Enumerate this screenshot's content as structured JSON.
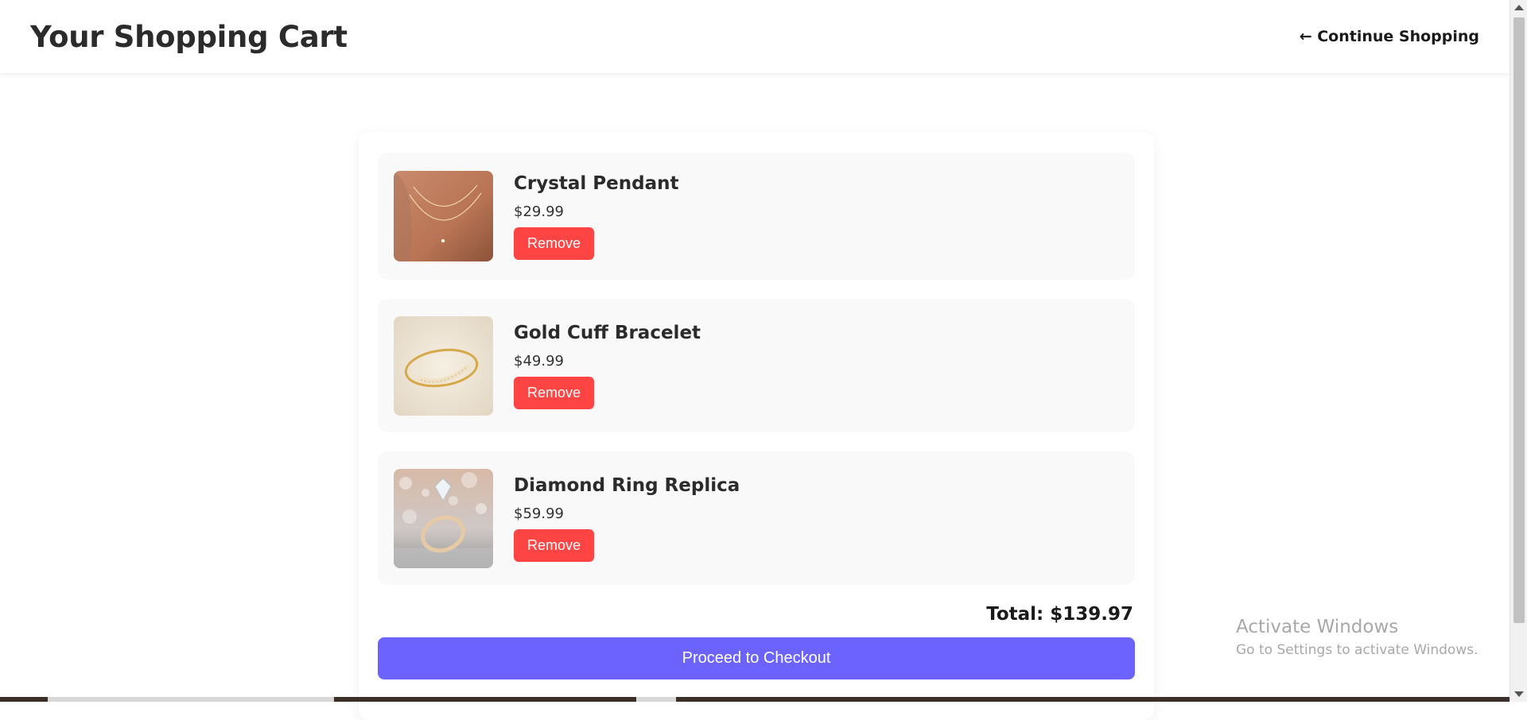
{
  "header": {
    "title": "Your Shopping Cart",
    "continue_link": "← Continue Shopping"
  },
  "cart": {
    "items": [
      {
        "name": "Crystal Pendant",
        "price": "$29.99",
        "remove_label": "Remove",
        "image": "necklace-photo"
      },
      {
        "name": "Gold Cuff Bracelet",
        "price": "$49.99",
        "remove_label": "Remove",
        "image": "bracelet-photo"
      },
      {
        "name": "Diamond Ring Replica",
        "price": "$59.99",
        "remove_label": "Remove",
        "image": "ring-photo"
      }
    ],
    "total": "Total: $139.97",
    "checkout_label": "Proceed to Checkout"
  },
  "watermark": {
    "line1": "Activate Windows",
    "line2": "Go to Settings to activate Windows."
  },
  "colors": {
    "remove": "#ff4444",
    "checkout": "#6c63ff",
    "item_bg": "#f9f9f9"
  }
}
